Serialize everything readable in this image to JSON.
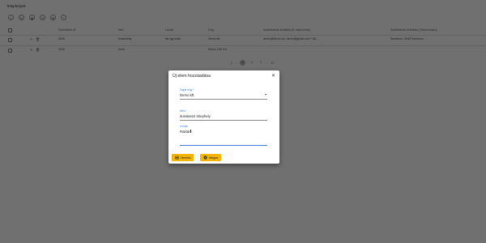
{
  "page": {
    "title": "Telephelyek",
    "toolbar_icons": [
      "add-icon",
      "refresh-icon",
      "view-icon",
      "filter-icon",
      "export-icon",
      "settings-icon"
    ],
    "columns": [
      "Szerződés ID",
      "Név",
      "Leírás",
      "Cég",
      "Szállítólevél-értesítés (E-mail címek)",
      "Szállítólevél-értesítés (Telefonszám)"
    ],
    "rows": [
      {
        "id": "3030",
        "nev": "lerakóhely",
        "leiras": "db egy kész",
        "ceg": "Demo kft.",
        "email": "demo@demo.hu; demo@gmail.com +36...",
        "tel": "Szerencs, 3940 Szerencs ..."
      },
      {
        "id": "3030",
        "nev": "Kecil",
        "leiras": "",
        "ceg": "Demo LIDI Kft.",
        "email": "",
        "tel": ""
      }
    ],
    "pager": {
      "pages": [
        "1",
        "2",
        "3"
      ],
      "active": "1",
      "per_page": "10"
    }
  },
  "dialog": {
    "title": "Új elem hozzáadása",
    "close_icon": "close-icon",
    "fields": {
      "company": {
        "label": "Saját cég *",
        "value": "Demo kft."
      },
      "name": {
        "label": "Név *",
        "value": "dunakeszi telephely"
      },
      "description": {
        "label": "Leírás",
        "value": "Raktár"
      }
    },
    "buttons": {
      "save": {
        "label": "Mentés",
        "icon": "save-icon"
      },
      "cancel": {
        "label": "Mégse",
        "icon": "cancel-icon"
      }
    }
  },
  "colors": {
    "accent": "#3f7bd6",
    "button": "#f4b400",
    "overlay": "rgba(0,0,0,0.56)"
  }
}
